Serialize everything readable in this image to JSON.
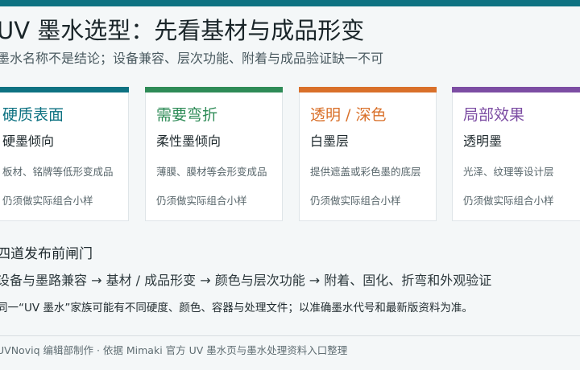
{
  "colors": {
    "accent": "#0e7282",
    "card_teal": "#0e7282",
    "card_green": "#2e8b57",
    "card_orange": "#d9702a",
    "card_purple": "#7c4da3"
  },
  "header": {
    "title": "UV 墨水选型：先看基材与成品形变",
    "subtitle": "墨水名称不是结论；设备兼容、层次功能、附着与成品验证缺一不可"
  },
  "cards": [
    {
      "title": "硬质表面",
      "type": "硬墨倾向",
      "desc": "板材、铭牌等低形变成品",
      "note": "仍须做实际组合小样"
    },
    {
      "title": "需要弯折",
      "type": "柔性墨倾向",
      "desc": "薄膜、膜材等会形变成品",
      "note": "仍须做实际组合小样"
    },
    {
      "title": "透明 / 深色",
      "type": "白墨层",
      "desc": "提供遮盖或彩色墨的底层",
      "note": "仍须做实际组合小样"
    },
    {
      "title": "局部效果",
      "type": "透明墨",
      "desc": "光泽、纹理等设计层",
      "note": "仍须做实际组合小样"
    }
  ],
  "gates": {
    "title": "四道发布前闸门",
    "flow": "设备与墨路兼容 → 基材 / 成品形变 → 颜色与层次功能 → 附着、固化、折弯和外观验证",
    "note": "同一“UV 墨水”家族可能有不同硬度、颜色、容器与处理文件；以准确墨水代号和最新版资料为准。"
  },
  "footer": {
    "credit": "UVNoviq 编辑部制作 · 依据 Mimaki 官方 UV 墨水页与墨水处理资料入口整理"
  }
}
